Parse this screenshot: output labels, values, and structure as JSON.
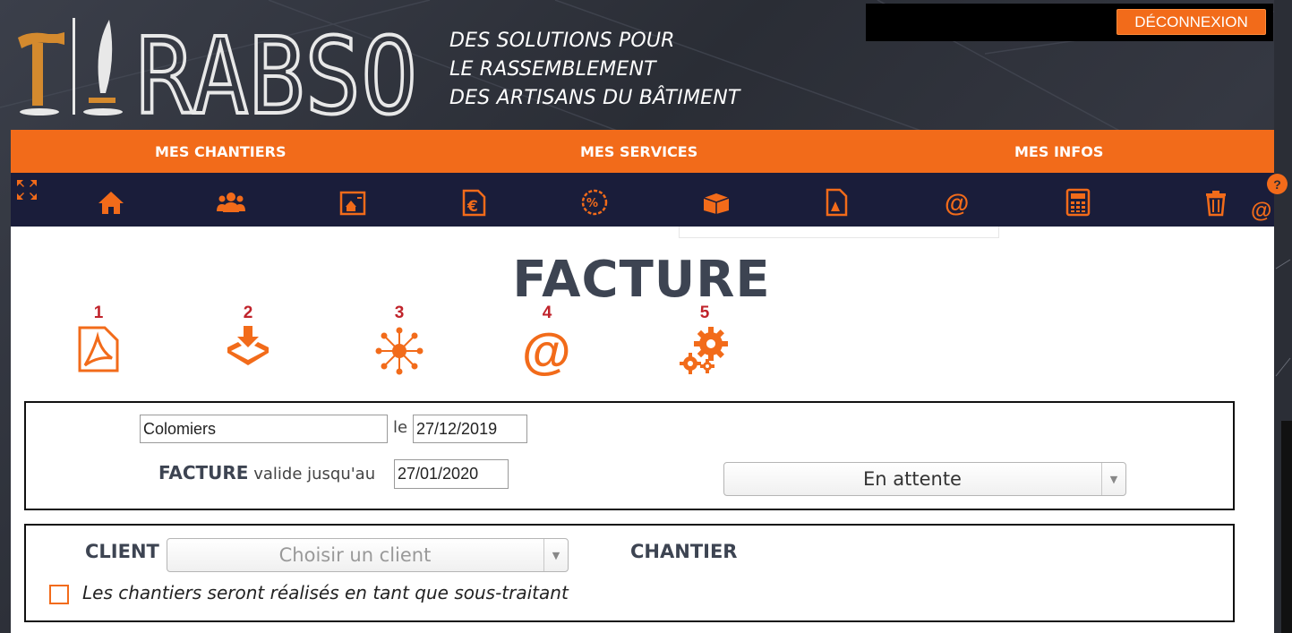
{
  "brand": {
    "logo_text": "RABSO",
    "tagline": [
      "DES SOLUTIONS POUR",
      "LE RASSEMBLEMENT",
      "DES ARTISANS DU BÂTIMENT"
    ]
  },
  "header": {
    "logout_label": "DÉCONNEXION"
  },
  "nav": {
    "items": [
      "MES CHANTIERS",
      "MES SERVICES",
      "MES INFOS"
    ]
  },
  "toolbar": {
    "icons": [
      "expand-icon",
      "home-icon",
      "users-icon",
      "estimate-icon",
      "invoice-euro-icon",
      "discount-icon",
      "box-icon",
      "document-icon",
      "email-icon",
      "calculator-icon",
      "trash-icon"
    ],
    "help_label": "?",
    "side_at": "@"
  },
  "page": {
    "title": "FACTURE"
  },
  "steps": [
    {
      "number": "1",
      "icon": "pdf-icon"
    },
    {
      "number": "2",
      "icon": "download-tray-icon"
    },
    {
      "number": "3",
      "icon": "network-icon"
    },
    {
      "number": "4",
      "icon": "at-sign-icon"
    },
    {
      "number": "5",
      "icon": "gears-icon"
    }
  ],
  "invoice": {
    "city": "Colomiers",
    "le_label": "le",
    "date": "27/12/2019",
    "facture_label": "FACTURE",
    "valid_label": "valide jusqu'au",
    "valid_until": "27/01/2020",
    "status": "En attente"
  },
  "client": {
    "client_label": "CLIENT",
    "client_placeholder": "Choisir un client",
    "chantier_label": "CHANTIER",
    "subcontract_label": "Les chantiers seront réalisés en tant que sous-traitant",
    "subcontract_checked": false
  },
  "colors": {
    "accent": "#f26b1a",
    "dark_bar": "#1a1d3a",
    "title": "#3d4452",
    "step_number": "#c0232b"
  }
}
